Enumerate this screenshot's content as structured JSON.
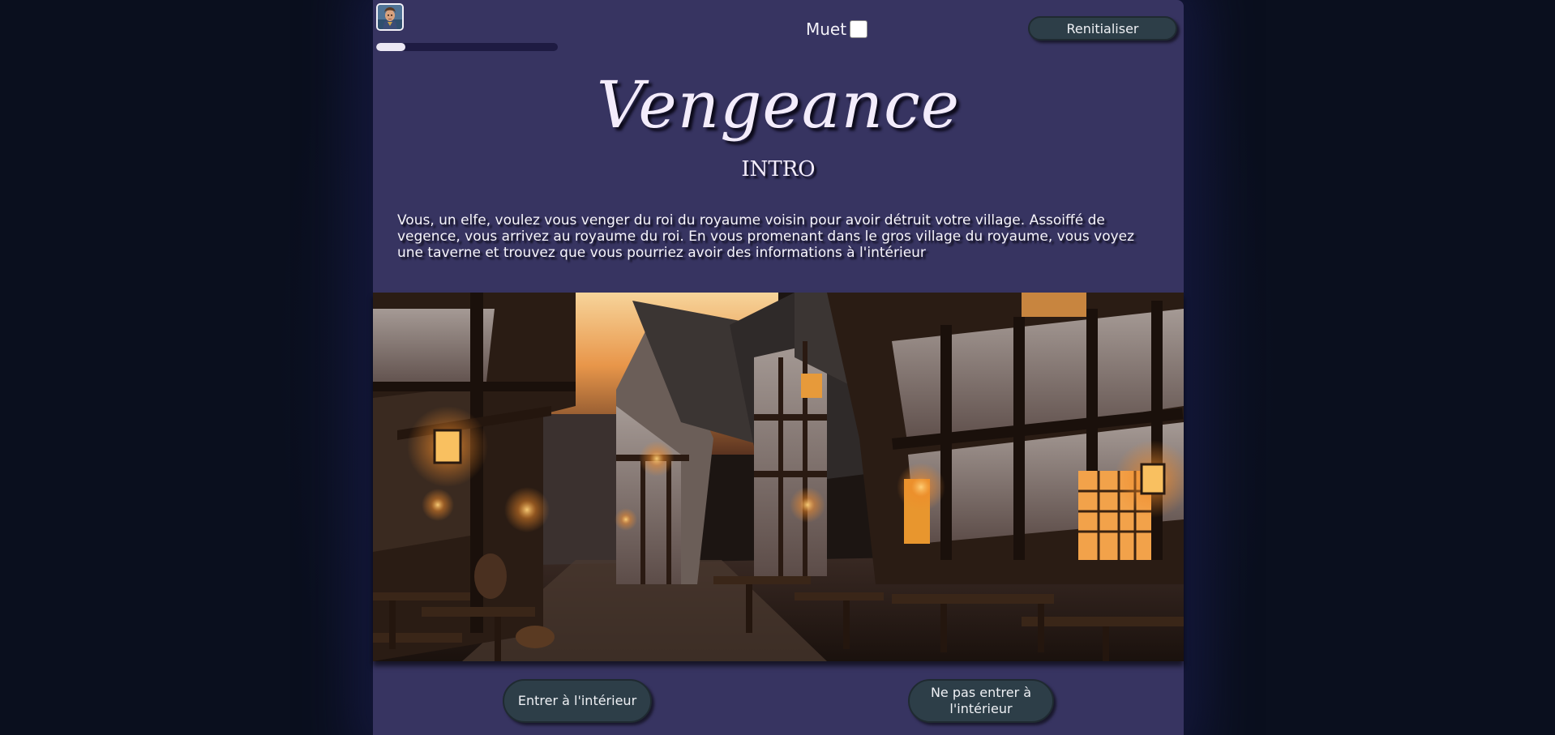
{
  "header": {
    "mute_label": "Muet",
    "mute_checked": false,
    "reset_label": "Renitialiser",
    "progress": 0.16,
    "avatar_icon": "elf-portrait-icon"
  },
  "story": {
    "title": "Vengeance",
    "chapter": "INTRO",
    "text": "Vous, un elfe, voulez vous venger du roi du royaume voisin pour avoir détruit votre village. Assoiffé de vegence, vous arrivez au royaume du roi. En vous promenant dans le gros village du royaume, vous voyez une taverne et trouvez que vous pourriez avoir des informations à l'intérieur"
  },
  "choices": [
    {
      "label": "Entrer à l'intérieur"
    },
    {
      "label": "Ne pas entrer à l'intérieur"
    }
  ],
  "colors": {
    "page_bg": "#0b1120",
    "panel_bg": "#373461",
    "button_bg": "#2d3e48",
    "text": "#f3ecfb"
  }
}
